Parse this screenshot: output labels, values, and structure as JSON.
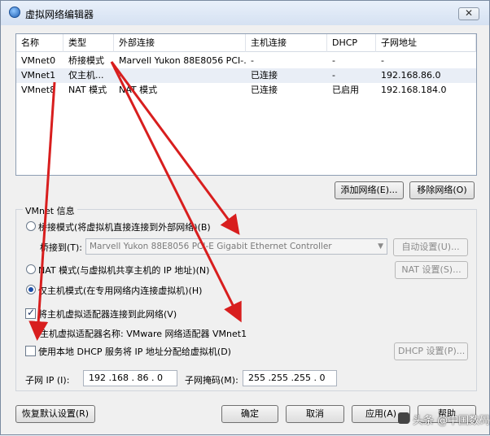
{
  "window": {
    "title": "虚拟网络编辑器",
    "close_glyph": "✕"
  },
  "network_list": {
    "headers": [
      "名称",
      "类型",
      "外部连接",
      "主机连接",
      "DHCP",
      "子网地址"
    ],
    "rows": [
      [
        "VMnet0",
        "桥接模式",
        "Marvell Yukon 88E8056 PCI-...",
        "-",
        "-",
        "-"
      ],
      [
        "VMnet1",
        "仅主机...",
        "-",
        "已连接",
        "-",
        "192.168.86.0"
      ],
      [
        "VMnet8",
        "NAT 模式",
        "NAT 模式",
        "已连接",
        "已启用",
        "192.168.184.0"
      ]
    ],
    "selected_row": 1
  },
  "list_buttons": {
    "add": "添加网络(E)...",
    "remove": "移除网络(O)"
  },
  "vmnet_info": {
    "group_label": "VMnet 信息",
    "bridged_radio": "桥接模式(将虚拟机直接连接到外部网络)(B)",
    "bridged_to_label": "桥接到(T):",
    "bridged_to_value": "Marvell Yukon 88E8056 PCI-E Gigabit Ethernet Controller",
    "auto_settings": "自动设置(U)...",
    "nat_radio": "NAT 模式(与虚拟机共享主机的 IP 地址)(N)",
    "nat_settings": "NAT 设置(S)...",
    "hostonly_radio": "仅主机模式(在专用网络内连接虚拟机)(H)",
    "connect_adapter_checkbox": "将主机虚拟适配器连接到此网络(V)",
    "adapter_name_label": "主机虚拟适配器名称: VMware 网络适配器 VMnet1",
    "dhcp_checkbox": "使用本地 DHCP 服务将 IP 地址分配给虚拟机(D)",
    "dhcp_settings": "DHCP 设置(P)...",
    "subnet_ip_label": "子网 IP (I):",
    "subnet_ip_value": "192 .168 . 86  .  0",
    "subnet_mask_label": "子网掩码(M):",
    "subnet_mask_value": "255 .255 .255 .  0",
    "selected_mode": "host-only",
    "connect_adapter_checked": true,
    "dhcp_checked": false
  },
  "bottom_buttons": {
    "restore": "恢复默认设置(R)",
    "ok": "确定",
    "cancel": "取消",
    "apply": "应用(A)",
    "help": "帮助"
  },
  "watermark": {
    "text": "头条 @中国数码"
  },
  "colors": {
    "annotation_arrow": "#d81e1e",
    "selected_row": "#e9eef6",
    "radio_dot": "#1b4ea8"
  }
}
